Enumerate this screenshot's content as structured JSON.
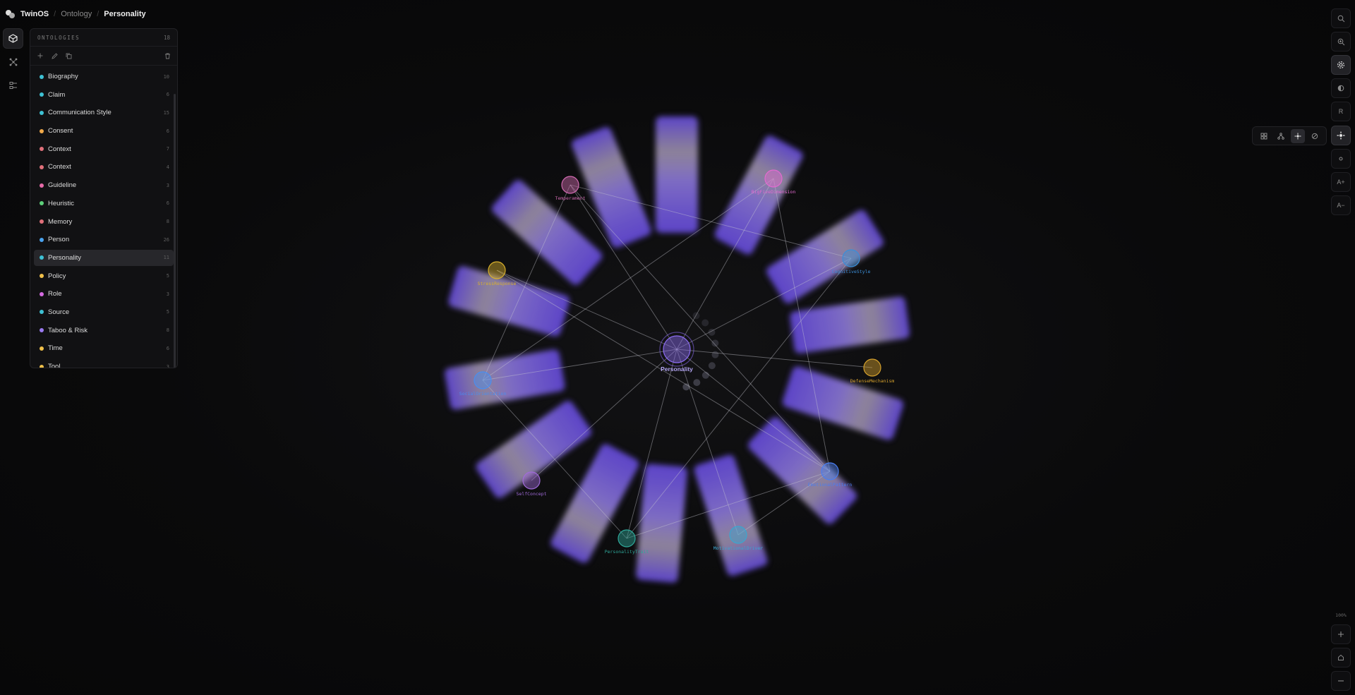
{
  "header": {
    "brand": "TwinOS",
    "breadcrumb": [
      "Ontology",
      "Personality"
    ]
  },
  "rail": {
    "items": [
      {
        "icon": "graph-cube-icon",
        "active": true
      },
      {
        "icon": "network-icon",
        "active": false
      },
      {
        "icon": "schema-icon",
        "active": false
      }
    ]
  },
  "ontologies": {
    "title": "ONTOLOGIES",
    "count": "18",
    "tools": [
      "plus-icon",
      "edit-icon",
      "copy-icon",
      "trash-icon"
    ],
    "items": [
      {
        "label": "Biography",
        "count": "10",
        "color": "#3ec1d3"
      },
      {
        "label": "Claim",
        "count": "6",
        "color": "#3ec1d3"
      },
      {
        "label": "Communication Style",
        "count": "15",
        "color": "#3ec1d3"
      },
      {
        "label": "Consent",
        "count": "6",
        "color": "#f0a94a"
      },
      {
        "label": "Context",
        "count": "7",
        "color": "#e0707a"
      },
      {
        "label": "Context",
        "count": "4",
        "color": "#e0707a"
      },
      {
        "label": "Guideline",
        "count": "3",
        "color": "#e66aa8"
      },
      {
        "label": "Heuristic",
        "count": "6",
        "color": "#5dd07a"
      },
      {
        "label": "Memory",
        "count": "8",
        "color": "#e0707a"
      },
      {
        "label": "Person",
        "count": "26",
        "color": "#4aa3f0"
      },
      {
        "label": "Personality",
        "count": "11",
        "color": "#3ec1d3",
        "selected": true
      },
      {
        "label": "Policy",
        "count": "5",
        "color": "#f0c04a"
      },
      {
        "label": "Role",
        "count": "3",
        "color": "#d46ae0"
      },
      {
        "label": "Source",
        "count": "5",
        "color": "#3ec1d3"
      },
      {
        "label": "Taboo & Risk",
        "count": "8",
        "color": "#9a7af0"
      },
      {
        "label": "Time",
        "count": "6",
        "color": "#f0c04a"
      },
      {
        "label": "Tool",
        "count": "3",
        "color": "#f0c04a"
      }
    ]
  },
  "right_toolbar": {
    "buttons": [
      {
        "icon": "search-icon",
        "label": ""
      },
      {
        "icon": "zoom-search-icon",
        "label": ""
      },
      {
        "icon": "gear-icon",
        "label": "",
        "active": true
      },
      {
        "icon": "contrast-icon",
        "label": ""
      },
      {
        "icon": "reset-icon",
        "label": "R"
      },
      {
        "icon": "layout-icon",
        "label": "",
        "active": true
      },
      {
        "icon": "dot-icon",
        "label": ""
      },
      {
        "icon": "font-increase-icon",
        "label": "A+"
      },
      {
        "icon": "font-decrease-icon",
        "label": "A−"
      }
    ],
    "popover": [
      "grid-icon",
      "tree-icon",
      "radial-icon",
      "off-icon"
    ],
    "zoom_level": "100%",
    "zoom_buttons": [
      "zoom-in-icon",
      "home-icon",
      "zoom-out-icon"
    ]
  },
  "graph": {
    "center": {
      "label": "Personality",
      "color": "#8b6cf0"
    },
    "nodes": [
      {
        "label": "Temperament",
        "color": "#d06ab0"
      },
      {
        "label": "BigFiveDimension",
        "color": "#e36ad0"
      },
      {
        "label": "CognitiveStyle",
        "color": "#3b8ed8"
      },
      {
        "label": "DefenseMechanism",
        "color": "#d4a02c"
      },
      {
        "label": "EmotionalPattern",
        "color": "#4a7ef0"
      },
      {
        "label": "MotivationalDriver",
        "color": "#3aa6d0"
      },
      {
        "label": "PersonalityTrait",
        "color": "#2fa89a"
      },
      {
        "label": "SelfConcept",
        "color": "#a06ad8"
      },
      {
        "label": "SocialOrientation",
        "color": "#4a8ef0"
      },
      {
        "label": "StressResponse",
        "color": "#d8b02c"
      }
    ]
  }
}
